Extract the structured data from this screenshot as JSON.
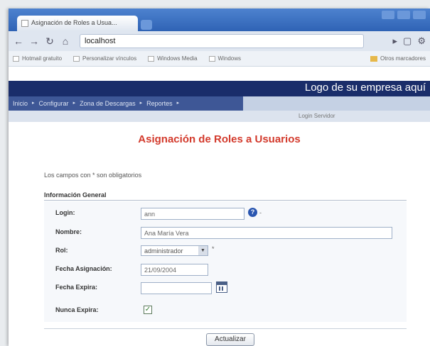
{
  "browser": {
    "tab_title": "Asignación de Roles a Usua...",
    "address": "localhost",
    "bookmarks": [
      "Hotmail gratuito",
      "Personalizar vínculos",
      "Windows Media",
      "Windows"
    ],
    "other_bookmarks": "Otros marcadores"
  },
  "banner": {
    "logo_text": "Logo de su empresa aquí"
  },
  "menu": {
    "items": [
      "Inicio",
      "Configurar",
      "Zona de Descargas",
      "Reportes"
    ],
    "separator": "▸"
  },
  "user_bar": {
    "label": "Login Servidor"
  },
  "page": {
    "title": "Asignación de Roles a Usuarios",
    "required_note": "Los campos con * son obligatorios",
    "section_title": "Información General"
  },
  "form": {
    "login": {
      "label": "Login:",
      "value": "ann",
      "help_suffix": "-"
    },
    "nombre": {
      "label": "Nombre:",
      "value": "Ana María Vera"
    },
    "rol": {
      "label": "Rol:",
      "value": "administrador",
      "required_mark": "*"
    },
    "fecha_asignacion": {
      "label": "Fecha Asignación:",
      "value": "21/09/2004"
    },
    "fecha_expira": {
      "label": "Fecha Expira:",
      "value": ""
    },
    "nunca_expira": {
      "label": "Nunca Expira:",
      "checked": true
    }
  },
  "actions": {
    "submit_label": "Actualizar"
  },
  "colors": {
    "banner_bg": "#1a2d6a",
    "menu_bg": "#3e5796",
    "title_red": "#d33a2c"
  }
}
